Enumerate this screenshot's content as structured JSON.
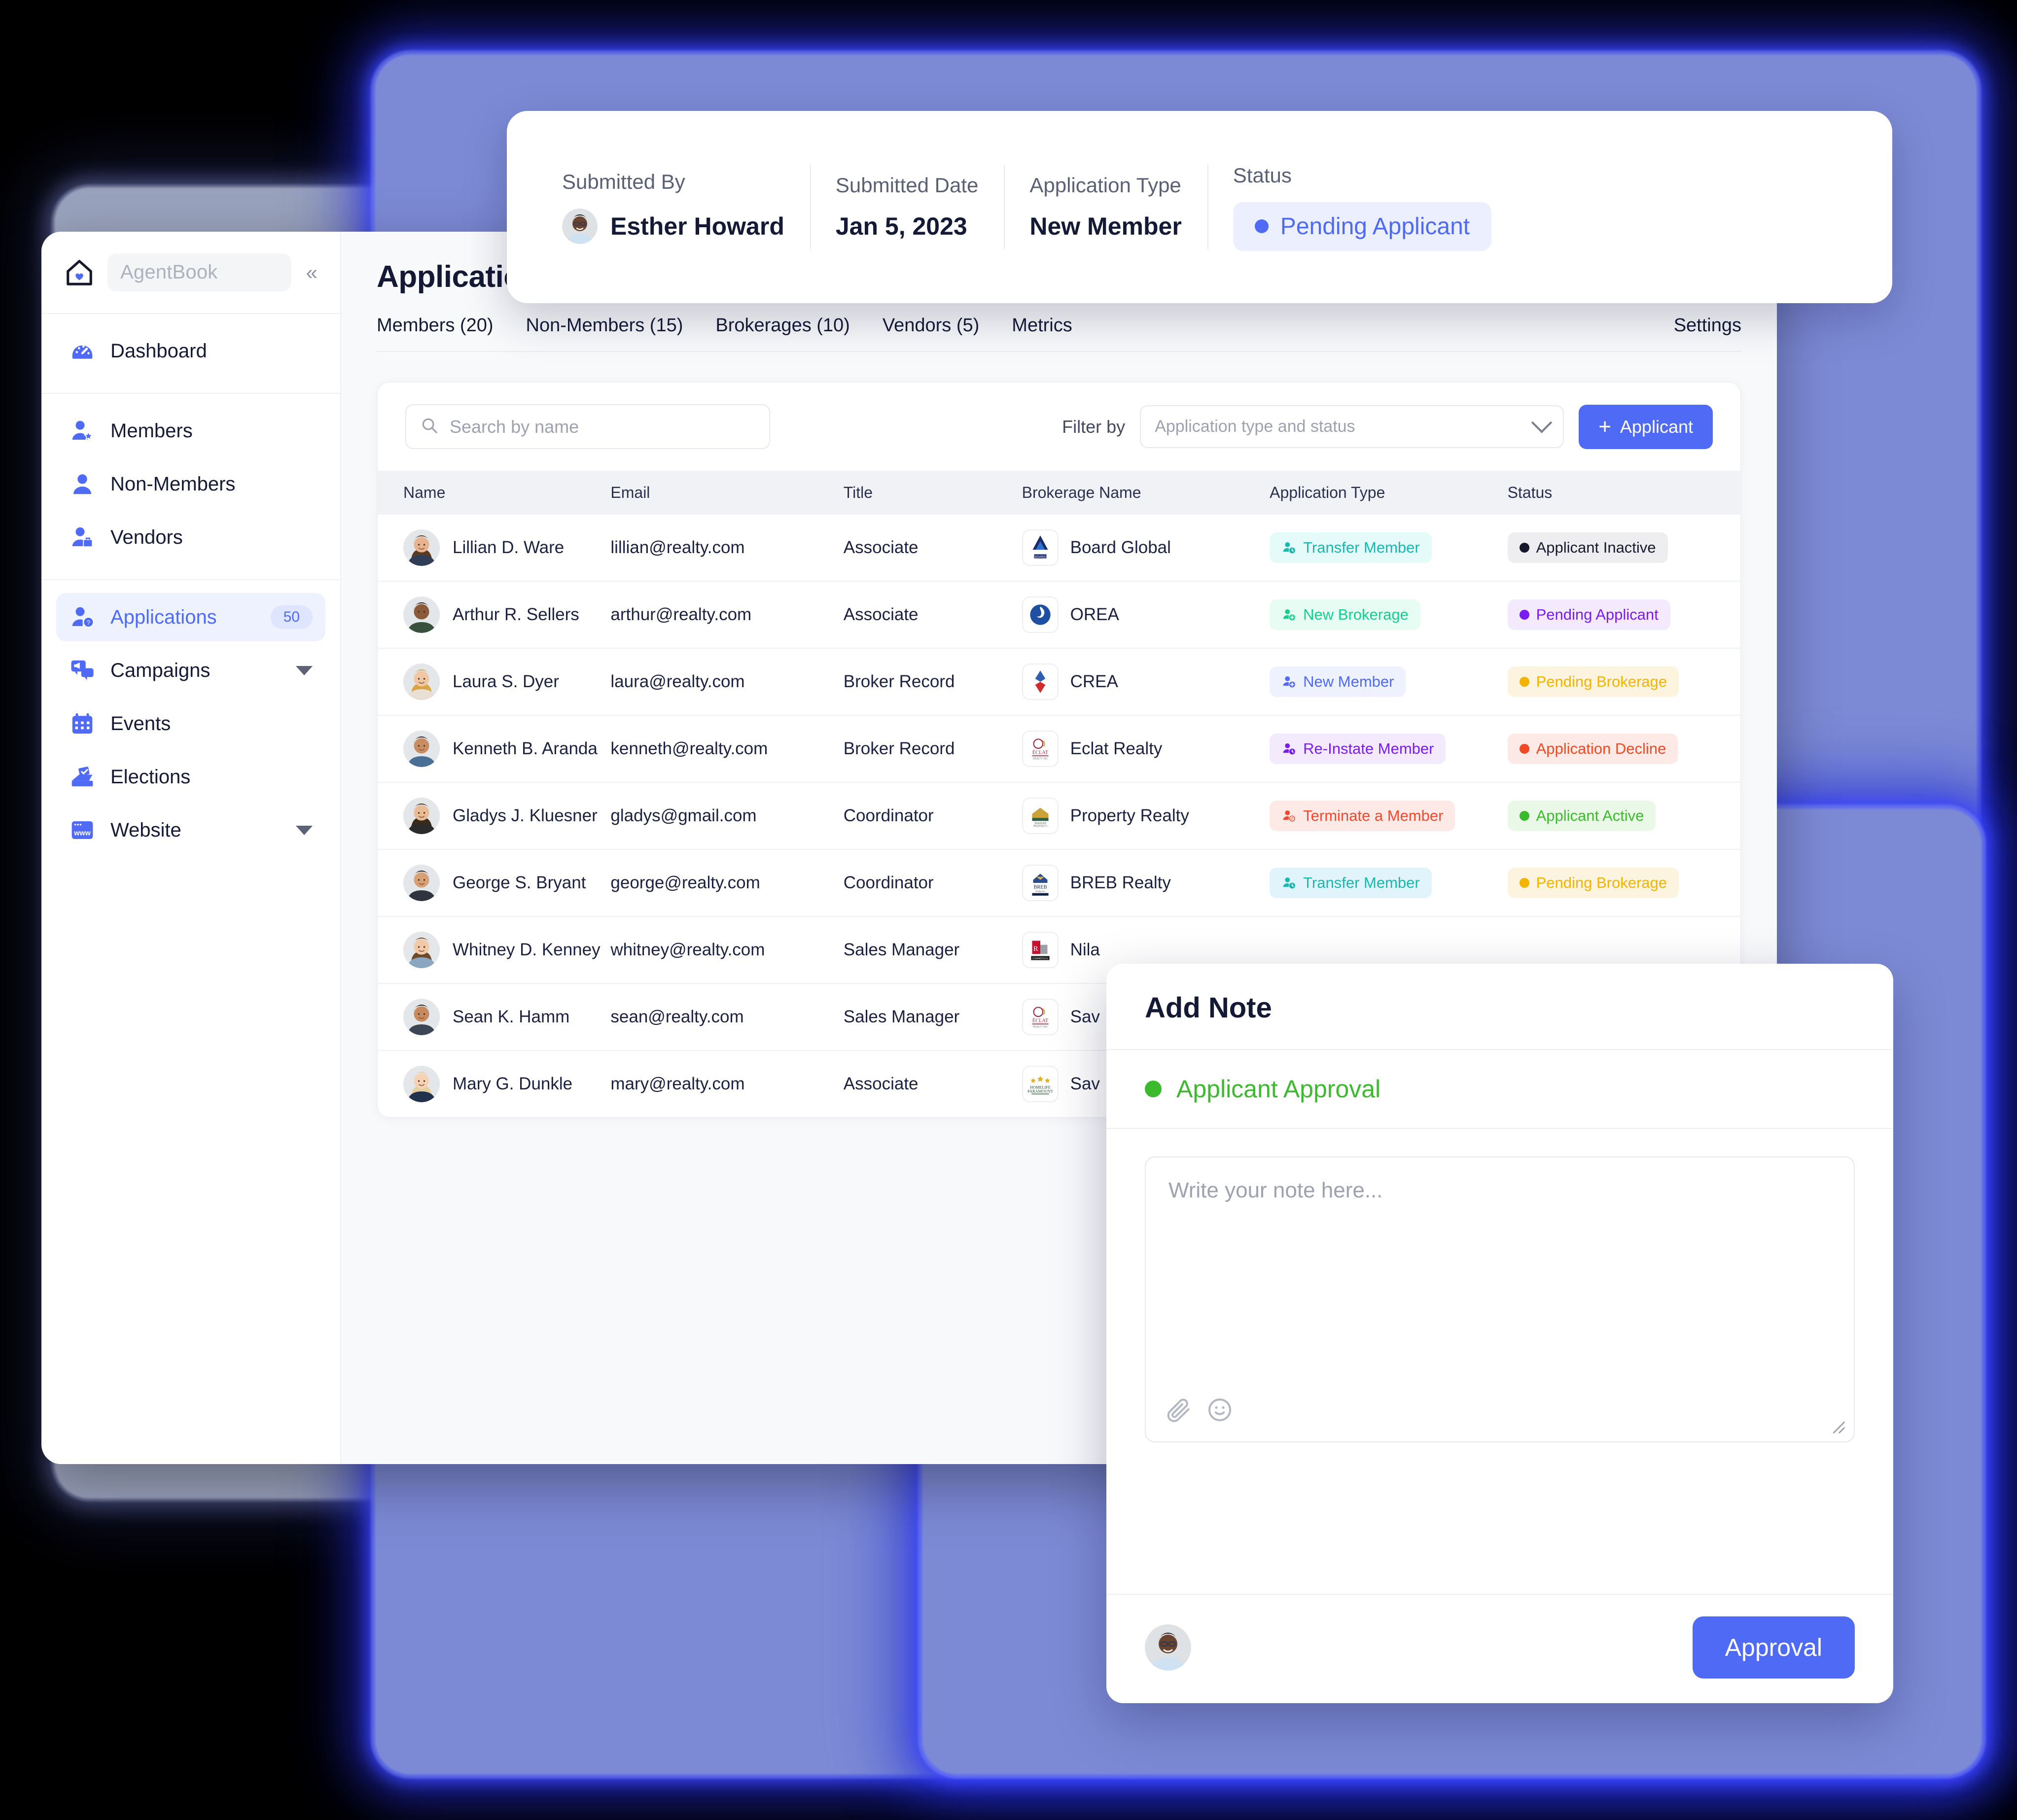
{
  "summary": {
    "submitted_by_label": "Submitted By",
    "submitted_by_value": "Esther Howard",
    "submitted_date_label": "Submitted Date",
    "submitted_date_value": "Jan 5, 2023",
    "application_type_label": "Application Type",
    "application_type_value": "New Member",
    "status_label": "Status",
    "status_value": "Pending Applicant",
    "status_color": "#4f6af5"
  },
  "sidebar": {
    "brand": "AgentBook",
    "collapse_icon": "chevrons-left-icon",
    "groups": [
      {
        "items": [
          {
            "label": "Dashboard",
            "icon": "dashboard-icon",
            "active": false
          }
        ]
      },
      {
        "items": [
          {
            "label": "Members",
            "icon": "member-star-icon",
            "active": false
          },
          {
            "label": "Non-Members",
            "icon": "user-icon",
            "active": false
          },
          {
            "label": "Vendors",
            "icon": "vendor-briefcase-icon",
            "active": false
          }
        ]
      },
      {
        "items": [
          {
            "label": "Applications",
            "icon": "applications-icon",
            "active": true,
            "badge": "50"
          },
          {
            "label": "Campaigns",
            "icon": "campaign-megaphone-icon",
            "active": false,
            "caret": true
          },
          {
            "label": "Events",
            "icon": "calendar-icon",
            "active": false
          },
          {
            "label": "Elections",
            "icon": "ballot-icon",
            "active": false
          },
          {
            "label": "Website",
            "icon": "browser-www-icon",
            "active": false,
            "caret": true
          }
        ]
      }
    ]
  },
  "page": {
    "title": "Applications",
    "tabs": [
      {
        "label": "Members (20)"
      },
      {
        "label": "Non-Members (15)"
      },
      {
        "label": "Brokerages (10)"
      },
      {
        "label": "Vendors (5)"
      },
      {
        "label": "Metrics"
      }
    ],
    "settings_label": "Settings"
  },
  "toolbar": {
    "search_placeholder": "Search by name",
    "search_value": "",
    "search_icon": "search-icon",
    "filter_by_label": "Filter by",
    "filter_placeholder": "Application type and status",
    "filter_value": "",
    "add_button_label": "Applicant",
    "add_button_icon": "plus-icon",
    "add_button_color": "#4f6af5"
  },
  "table": {
    "columns": [
      "Name",
      "Email",
      "Title",
      "Brokerage Name",
      "Application Type",
      "Status"
    ],
    "rows": [
      {
        "name": "Lillian D. Ware",
        "email": "lillian@realty.com",
        "title": "Associate",
        "brokerage": "Board Global",
        "brokerage_logo": "board-global-logo",
        "type": "Transfer Member",
        "type_fg": "#17b8b0",
        "type_bg": "#e4fbfa",
        "status": "Applicant Inactive",
        "status_fg": "#16192e",
        "status_bg": "#eeeef0"
      },
      {
        "name": "Arthur R. Sellers",
        "email": "arthur@realty.com",
        "title": "Associate",
        "brokerage": "OREA",
        "brokerage_logo": "orea-logo",
        "type": "New Brokerage",
        "type_fg": "#14cf8e",
        "type_bg": "#e7fdf4",
        "status": "Pending Applicant",
        "status_fg": "#7a1bf0",
        "status_bg": "#f4eafe"
      },
      {
        "name": "Laura S. Dyer",
        "email": "laura@realty.com",
        "title": "Broker Record",
        "brokerage": "CREA",
        "brokerage_logo": "crea-logo",
        "type": "New Member",
        "type_fg": "#4f6af5",
        "type_bg": "#eef1fe",
        "status": "Pending Brokerage",
        "status_fg": "#f5b301",
        "status_bg": "#fdf4e0"
      },
      {
        "name": "Kenneth B. Aranda",
        "email": "kenneth@realty.com",
        "title": "Broker Record",
        "brokerage": "Eclat Realty",
        "brokerage_logo": "eclat-realty-logo",
        "type": "Re-Instate Member",
        "type_fg": "#7a1bf0",
        "type_bg": "#f3eafe",
        "status": "Application Decline",
        "status_fg": "#ef4a23",
        "status_bg": "#fdeae6"
      },
      {
        "name": "Gladys J. Kluesner",
        "email": "gladys@gmail.com",
        "title": "Coordinator",
        "brokerage": "Property Realty",
        "brokerage_logo": "property-realty-logo",
        "type": "Terminate a Member",
        "type_fg": "#f4492d",
        "type_bg": "#fdeae7",
        "status": "Applicant Active",
        "status_fg": "#3cba2e",
        "status_bg": "#eaf8e8"
      },
      {
        "name": "George S. Bryant",
        "email": "george@realty.com",
        "title": "Coordinator",
        "brokerage": "BREB Realty",
        "brokerage_logo": "breb-realty-logo",
        "type": "Transfer Member",
        "type_fg": "#17b8b0",
        "type_bg": "#e1f4fb",
        "status": "Pending Brokerage",
        "status_fg": "#f5b301",
        "status_bg": "#fdf4e0"
      },
      {
        "name": "Whitney D. Kenney",
        "email": "whitney@realty.com",
        "title": "Sales Manager",
        "brokerage": "Nila",
        "brokerage_logo": "rlp-commercial-logo",
        "type": "",
        "type_fg": "",
        "type_bg": "",
        "status": "",
        "status_fg": "",
        "status_bg": ""
      },
      {
        "name": "Sean K. Hamm",
        "email": "sean@realty.com",
        "title": "Sales Manager",
        "brokerage": "Sav",
        "brokerage_logo": "eclat-realty-logo",
        "type": "",
        "type_fg": "",
        "type_bg": "",
        "status": "",
        "status_fg": "",
        "status_bg": ""
      },
      {
        "name": "Mary G. Dunkle",
        "email": "mary@realty.com",
        "title": "Associate",
        "brokerage": "Sav",
        "brokerage_logo": "homelife-paramount-logo",
        "type": "",
        "type_fg": "",
        "type_bg": "",
        "status": "",
        "status_fg": "",
        "status_bg": ""
      }
    ]
  },
  "note_dialog": {
    "title": "Add Note",
    "status_label": "Applicant Approval",
    "status_color": "#3cba2e",
    "textarea_placeholder": "Write your note here...",
    "textarea_value": "",
    "attach_icon": "paperclip-icon",
    "emoji_icon": "smiley-icon",
    "avatar": "user-avatar",
    "submit_label": "Approval",
    "submit_color": "#4f6af5"
  }
}
